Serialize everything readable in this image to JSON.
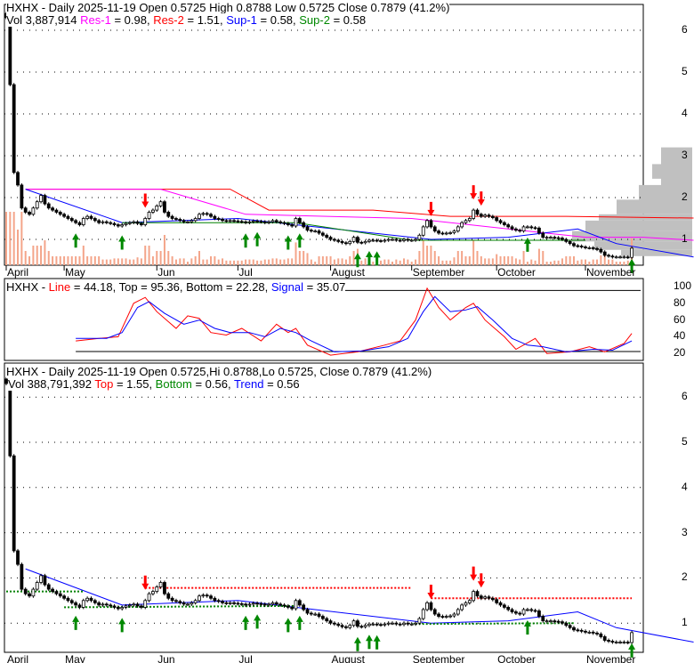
{
  "top_panel": {
    "title": "HXHX - Daily 2025-11-19 Open 0.5725  High 0.8788  Low 0.5725  Close 0.7879 (41.2%)",
    "vol": "Vol 3,887,914",
    "res1_label": "Res-1",
    "res1_value": " = 0.98, ",
    "res2_label": "Res-2",
    "res2_value": " = 1.51, ",
    "sup1_label": "Sup-1",
    "sup1_value": " = 0.58, ",
    "sup2_label": "Sup-2",
    "sup2_value": " = 0.58"
  },
  "mid_panel": {
    "ticker": "HXHX - ",
    "line_label": "Line",
    "line_value": " = 44.18, Top = 95.36, Bottom = 22.28, ",
    "signal_label": "Signal",
    "signal_value": " = 35.07"
  },
  "bottom_panel": {
    "title": "HXHX - Daily 2025-11-19 Open 0.5725,Hi 0.8788,Lo 0.5725, Close 0.7879 (41.2%)",
    "vol": "Vol 388,791,392 ",
    "top_label": "Top",
    "top_value": " = 1.55, ",
    "bottom_label": "Bottom",
    "bottom_value": " = 0.56, ",
    "trend_label": "Trend",
    "trend_value": " = 0.56"
  },
  "colors": {
    "res1": "#ff00ff",
    "res2": "#ff0000",
    "sup1": "#0000ff",
    "sup2": "#008000",
    "volume": "#f4a58a",
    "profile": "#c0c0c0"
  },
  "chart_data": [
    {
      "type": "candlestick",
      "title": "HXHX - Daily",
      "months": [
        "April",
        "May",
        "Jun",
        "Jul",
        "August",
        "September",
        "October",
        "November"
      ],
      "month_bar_counts": [
        15,
        24,
        21,
        24,
        21,
        22,
        23,
        13
      ],
      "price_ticks": [
        "1",
        "2",
        "3",
        "4",
        "5",
        "6"
      ],
      "closes": [
        6.3,
        4.7,
        2.6,
        2.3,
        1.75,
        1.65,
        1.6,
        1.75,
        1.9,
        2.05,
        1.85,
        1.75,
        1.7,
        1.65,
        1.6,
        1.55,
        1.5,
        1.45,
        1.4,
        1.35,
        1.5,
        1.55,
        1.5,
        1.45,
        1.4,
        1.42,
        1.4,
        1.38,
        1.35,
        1.32,
        1.35,
        1.38,
        1.4,
        1.42,
        1.38,
        1.35,
        1.5,
        1.65,
        1.7,
        1.8,
        1.9,
        1.65,
        1.55,
        1.5,
        1.48,
        1.45,
        1.42,
        1.42,
        1.45,
        1.5,
        1.6,
        1.62,
        1.6,
        1.55,
        1.5,
        1.48,
        1.45,
        1.44,
        1.45,
        1.44,
        1.43,
        1.42,
        1.4,
        1.42,
        1.44,
        1.43,
        1.42,
        1.4,
        1.42,
        1.45,
        1.42,
        1.4,
        1.38,
        1.35,
        1.32,
        1.5,
        1.4,
        1.3,
        1.22,
        1.2,
        1.2,
        1.15,
        1.1,
        1.05,
        1.0,
        0.98,
        0.95,
        0.92,
        0.9,
        0.95,
        1.05,
        0.93,
        0.92,
        0.95,
        0.98,
        0.98,
        0.97,
        0.96,
        0.98,
        1.0,
        1.0,
        0.98,
        0.97,
        1.0,
        0.98,
        0.98,
        1.0,
        1.1,
        1.3,
        1.45,
        1.3,
        1.2,
        1.15,
        1.14,
        1.15,
        1.16,
        1.2,
        1.3,
        1.4,
        1.45,
        1.5,
        1.7,
        1.6,
        1.55,
        1.58,
        1.55,
        1.52,
        1.45,
        1.4,
        1.35,
        1.3,
        1.25,
        1.22,
        1.2,
        1.3,
        1.3,
        1.28,
        1.27,
        1.15,
        1.05,
        1.05,
        1.05,
        1.04,
        1.03,
        1.0,
        0.95,
        0.9,
        0.85,
        0.84,
        0.82,
        0.8,
        0.8,
        0.78,
        0.76,
        0.7,
        0.62,
        0.6,
        0.58,
        0.58,
        0.58,
        0.58,
        0.57,
        0.79
      ],
      "res1": [
        [
          5,
          2.2
        ],
        [
          40,
          2.2
        ],
        [
          62,
          1.6
        ],
        [
          105,
          1.5
        ],
        [
          140,
          1.15
        ],
        [
          150,
          1.05
        ],
        [
          165,
          1.05
        ],
        [
          178,
          0.98
        ]
      ],
      "res2": [
        [
          5,
          2.2
        ],
        [
          58,
          2.2
        ],
        [
          68,
          1.7
        ],
        [
          95,
          1.7
        ],
        [
          115,
          1.55
        ],
        [
          145,
          1.55
        ],
        [
          178,
          1.51
        ]
      ],
      "sup1": [
        [
          5,
          2.2
        ],
        [
          30,
          1.4
        ],
        [
          60,
          1.5
        ],
        [
          110,
          1.0
        ],
        [
          130,
          1.05
        ],
        [
          148,
          1.25
        ],
        [
          158,
          0.9
        ],
        [
          178,
          0.58
        ]
      ],
      "sup2": [
        [
          30,
          1.4
        ],
        [
          75,
          1.4
        ],
        [
          105,
          0.98
        ],
        [
          150,
          0.98
        ]
      ],
      "buy_arrows": [
        18,
        30,
        62,
        65,
        73,
        76,
        91,
        94,
        96,
        135,
        162
      ],
      "sell_arrows": [
        36,
        110,
        121,
        123
      ]
    },
    {
      "type": "line",
      "series": [
        {
          "name": "Line",
          "color": "#ff0000",
          "points": [
            [
              18,
              35
            ],
            [
              24,
              38
            ],
            [
              29,
              40
            ],
            [
              33,
              80
            ],
            [
              36,
              87
            ],
            [
              39,
              70
            ],
            [
              44,
              50
            ],
            [
              47,
              65
            ],
            [
              50,
              62
            ],
            [
              53,
              45
            ],
            [
              57,
              42
            ],
            [
              61,
              50
            ],
            [
              66,
              35
            ],
            [
              70,
              55
            ],
            [
              73,
              45
            ],
            [
              75,
              50
            ],
            [
              78,
              30
            ],
            [
              84,
              18
            ],
            [
              91,
              22
            ],
            [
              98,
              30
            ],
            [
              102,
              35
            ],
            [
              106,
              60
            ],
            [
              109,
              98
            ],
            [
              112,
              75
            ],
            [
              115,
              60
            ],
            [
              119,
              75
            ],
            [
              121,
              80
            ],
            [
              124,
              60
            ],
            [
              129,
              40
            ],
            [
              132,
              25
            ],
            [
              137,
              38
            ],
            [
              140,
              20
            ],
            [
              146,
              22
            ],
            [
              151,
              28
            ],
            [
              155,
              22
            ],
            [
              160,
              32
            ],
            [
              162,
              44
            ]
          ]
        },
        {
          "name": "Signal",
          "color": "#0000ff",
          "points": [
            [
              18,
              38
            ],
            [
              26,
              38
            ],
            [
              30,
              45
            ],
            [
              34,
              75
            ],
            [
              37,
              82
            ],
            [
              41,
              68
            ],
            [
              46,
              55
            ],
            [
              50,
              60
            ],
            [
              54,
              50
            ],
            [
              58,
              45
            ],
            [
              63,
              45
            ],
            [
              67,
              40
            ],
            [
              71,
              50
            ],
            [
              75,
              45
            ],
            [
              79,
              35
            ],
            [
              85,
              22
            ],
            [
              92,
              23
            ],
            [
              99,
              28
            ],
            [
              104,
              38
            ],
            [
              108,
              70
            ],
            [
              111,
              88
            ],
            [
              115,
              70
            ],
            [
              119,
              72
            ],
            [
              122,
              76
            ],
            [
              126,
              60
            ],
            [
              131,
              38
            ],
            [
              135,
              30
            ],
            [
              139,
              28
            ],
            [
              145,
              22
            ],
            [
              152,
              25
            ],
            [
              157,
              24
            ],
            [
              162,
              35
            ]
          ]
        }
      ],
      "y_ticks": [
        "20",
        "40",
        "60",
        "80",
        "100"
      ],
      "top": 95.36,
      "bottom": 22.28
    }
  ]
}
